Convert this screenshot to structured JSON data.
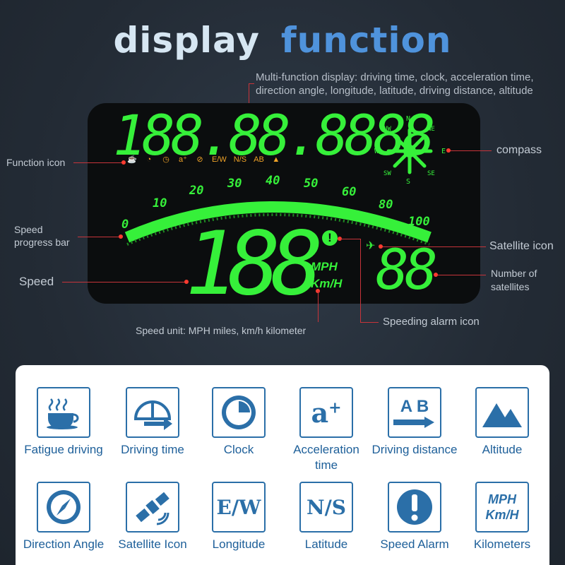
{
  "title": {
    "word1": "display",
    "word2": "function"
  },
  "multi_note": [
    "Multi-function display: driving time, clock, acceleration time,",
    "direction angle, longitude, latitude, driving distance, altitude"
  ],
  "labels": {
    "function_icon": "Function icon",
    "compass": "compass",
    "speed_bar": [
      "Speed",
      "progress bar"
    ],
    "satellite_icon": "Satellite icon",
    "speed": "Speed",
    "num_sat": [
      "Number of",
      "satellites"
    ],
    "speeding_alarm": "Speeding alarm icon",
    "speed_unit": "Speed unit: MPH miles, km/h kilometer"
  },
  "display": {
    "multi_digits": "188.88.8888",
    "func_icons": [
      "☕",
      "◔",
      "◷",
      "a⁺",
      "⊘",
      "E/W",
      "N/S",
      "AB",
      "▲"
    ],
    "speed_ticks": [
      "0",
      "10",
      "20",
      "30",
      "40",
      "50",
      "60",
      "80",
      "100"
    ],
    "speed_digits": "188",
    "unit_mph": "MPH",
    "unit_kmh": "Km/H",
    "sat_digits": "88",
    "compass_dirs": {
      "n": "N",
      "s": "S",
      "e": "E",
      "w": "W",
      "ne": "NE",
      "nw": "NW",
      "se": "SE",
      "sw": "SW"
    }
  },
  "features": [
    {
      "name": "Fatigue driving"
    },
    {
      "name": "Driving time"
    },
    {
      "name": "Clock"
    },
    {
      "name": "Acceleration time"
    },
    {
      "name": "Driving distance"
    },
    {
      "name": "Altitude"
    },
    {
      "name": "Direction Angle"
    },
    {
      "name": "Satellite Icon"
    },
    {
      "name": "Longitude"
    },
    {
      "name": "Latitude"
    },
    {
      "name": "Speed Alarm"
    },
    {
      "name": "Kilometers"
    }
  ],
  "feature_icon_text": {
    "ab": "A B",
    "ew": "E/W",
    "ns": "N/S",
    "mph": "MPH",
    "kmh": "Km/H",
    "accel": "a"
  },
  "colors": {
    "segment_green": "#36f03a",
    "accent_blue": "#2b6fa8",
    "pointer_red": "#ff3b30",
    "icon_orange": "#f0a328"
  }
}
